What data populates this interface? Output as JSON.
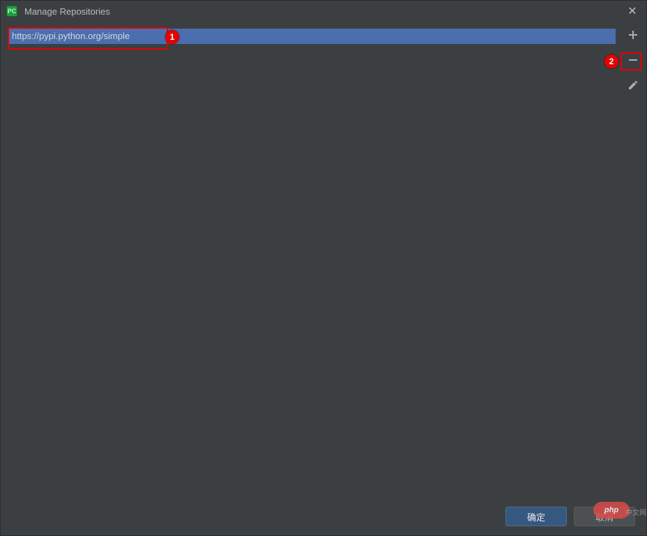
{
  "titlebar": {
    "app_icon_text": "PC",
    "title": "Manage Repositories",
    "close_glyph": "✕"
  },
  "repositories": {
    "items": [
      {
        "url": "https://pypi.python.org/simple"
      }
    ]
  },
  "toolbar": {
    "add_tooltip": "Add",
    "remove_tooltip": "Remove",
    "edit_tooltip": "Edit"
  },
  "footer": {
    "ok_label": "确定",
    "cancel_label": "取消"
  },
  "annotations": {
    "callout1": "1",
    "callout2": "2"
  },
  "watermark": {
    "label": "php",
    "tail": "中文网"
  }
}
